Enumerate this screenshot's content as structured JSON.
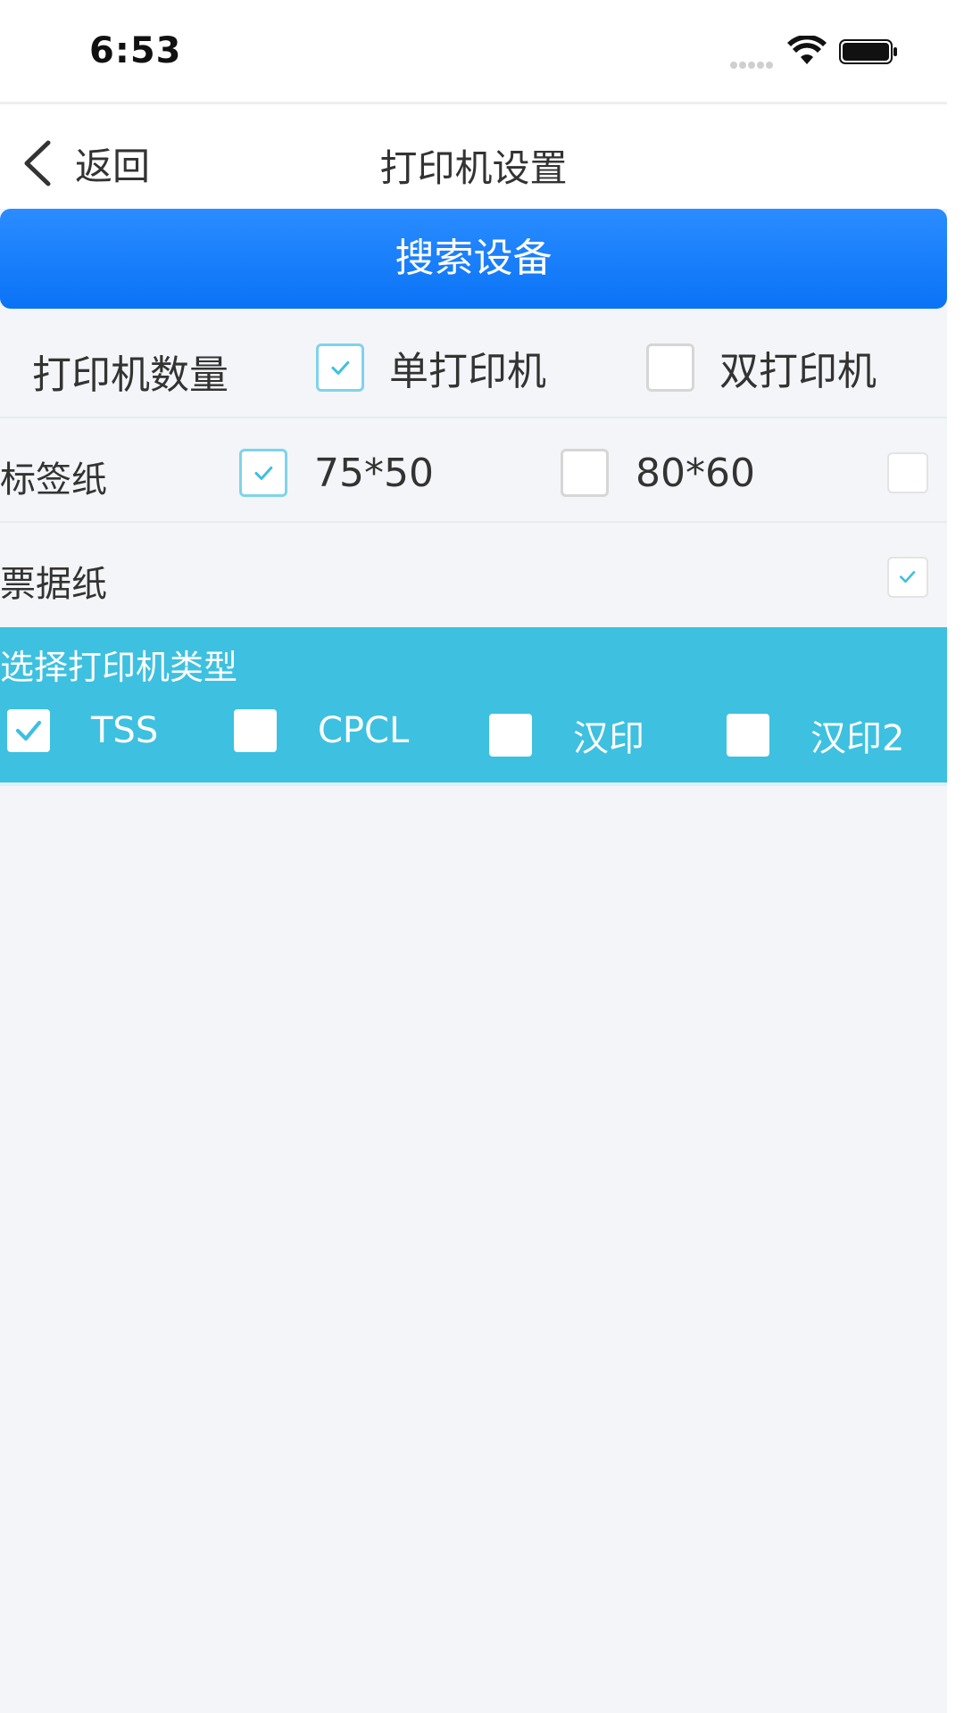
{
  "status_bar": {
    "time": "6:53"
  },
  "nav": {
    "back_label": "返回",
    "title": "打印机设置"
  },
  "search_button": {
    "label": "搜索设备"
  },
  "printer_count": {
    "label": "打印机数量",
    "options": [
      {
        "label": "单打印机",
        "checked": true
      },
      {
        "label": "双打印机",
        "checked": false
      }
    ]
  },
  "label_paper": {
    "label": "标签纸",
    "options": [
      {
        "label": "75*50",
        "checked": true
      },
      {
        "label": "80*60",
        "checked": false
      }
    ],
    "enabled": false
  },
  "receipt_paper": {
    "label": "票据纸",
    "enabled": true
  },
  "printer_type": {
    "title": "选择打印机类型",
    "options": [
      {
        "label": "TSS",
        "checked": true
      },
      {
        "label": "CPCL",
        "checked": false
      },
      {
        "label": "汉印",
        "checked": false
      },
      {
        "label": "汉印2",
        "checked": false
      }
    ]
  },
  "colors": {
    "primary": "#0a73f6",
    "panel": "#3ec0e0",
    "check": "#3ec0e0",
    "background": "#f3f5f8"
  }
}
